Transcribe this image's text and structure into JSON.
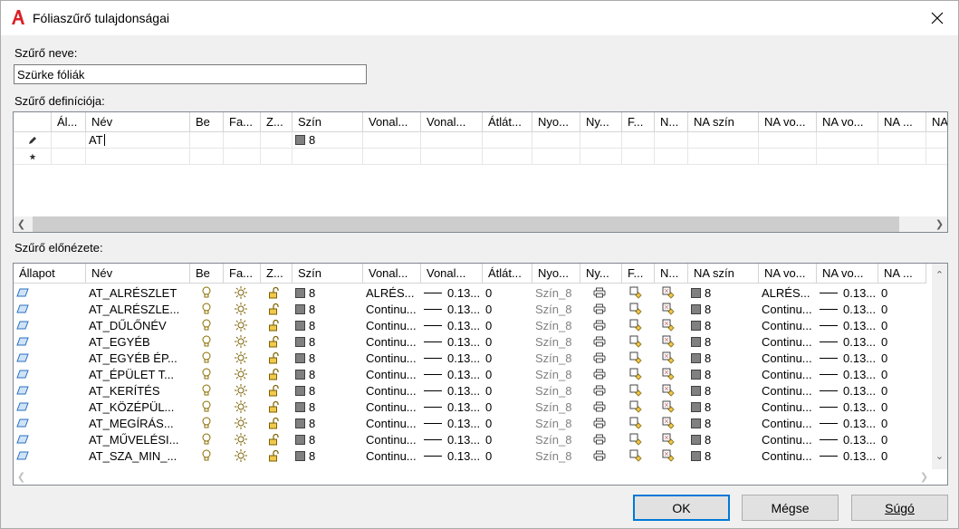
{
  "window": {
    "title": "Fóliaszűrő tulajdonságai"
  },
  "filter_name": {
    "label": "Szűrő neve:",
    "value": "Szürke fóliák"
  },
  "definition": {
    "label": "Szűrő definíciója:",
    "columns": [
      "",
      "Ál...",
      "Név",
      "Be",
      "Fa...",
      "Z...",
      "Szín",
      "Vonal...",
      "Vonal...",
      "Átlát...",
      "Nyo...",
      "Ny...",
      "F...",
      "N...",
      "NA szín",
      "NA vo...",
      "NA vo...",
      "NA ...",
      "NA"
    ],
    "rows": [
      {
        "marker": "pencil",
        "name": "AT",
        "color": "8"
      },
      {
        "marker": "new"
      }
    ]
  },
  "preview": {
    "label": "Szűrő előnézete:",
    "columns": [
      "Állapot",
      "Név",
      "Be",
      "Fa...",
      "Z...",
      "Szín",
      "Vonal...",
      "Vonal...",
      "Átlát...",
      "Nyo...",
      "Ny...",
      "F...",
      "N...",
      "NA szín",
      "NA vo...",
      "NA vo...",
      "NA ..."
    ],
    "rows": [
      {
        "name": "AT_ALRÉSZLET",
        "color": "8",
        "linetype": "ALRÉS...",
        "lineweight": "0.13...",
        "transparency": "0",
        "plotstyle": "Szín_8",
        "vp_color": "8",
        "vp_linetype": "ALRÉS...",
        "vp_lineweight": "0.13...",
        "vp_transparency": "0"
      },
      {
        "name": "AT_ALRÉSZLE...",
        "color": "8",
        "linetype": "Continu...",
        "lineweight": "0.13...",
        "transparency": "0",
        "plotstyle": "Szín_8",
        "vp_color": "8",
        "vp_linetype": "Continu...",
        "vp_lineweight": "0.13...",
        "vp_transparency": "0"
      },
      {
        "name": "AT_DŰLŐNÉV",
        "color": "8",
        "linetype": "Continu...",
        "lineweight": "0.13...",
        "transparency": "0",
        "plotstyle": "Szín_8",
        "vp_color": "8",
        "vp_linetype": "Continu...",
        "vp_lineweight": "0.13...",
        "vp_transparency": "0"
      },
      {
        "name": "AT_EGYÉB",
        "color": "8",
        "linetype": "Continu...",
        "lineweight": "0.13...",
        "transparency": "0",
        "plotstyle": "Szín_8",
        "vp_color": "8",
        "vp_linetype": "Continu...",
        "vp_lineweight": "0.13...",
        "vp_transparency": "0"
      },
      {
        "name": "AT_EGYÉB ÉP...",
        "color": "8",
        "linetype": "Continu...",
        "lineweight": "0.13...",
        "transparency": "0",
        "plotstyle": "Szín_8",
        "vp_color": "8",
        "vp_linetype": "Continu...",
        "vp_lineweight": "0.13...",
        "vp_transparency": "0"
      },
      {
        "name": "AT_ÉPÜLET T...",
        "color": "8",
        "linetype": "Continu...",
        "lineweight": "0.13...",
        "transparency": "0",
        "plotstyle": "Szín_8",
        "vp_color": "8",
        "vp_linetype": "Continu...",
        "vp_lineweight": "0.13...",
        "vp_transparency": "0"
      },
      {
        "name": "AT_KERÍTÉS",
        "color": "8",
        "linetype": "Continu...",
        "lineweight": "0.13...",
        "transparency": "0",
        "plotstyle": "Szín_8",
        "vp_color": "8",
        "vp_linetype": "Continu...",
        "vp_lineweight": "0.13...",
        "vp_transparency": "0"
      },
      {
        "name": "AT_KÖZÉPÜL...",
        "color": "8",
        "linetype": "Continu...",
        "lineweight": "0.13...",
        "transparency": "0",
        "plotstyle": "Szín_8",
        "vp_color": "8",
        "vp_linetype": "Continu...",
        "vp_lineweight": "0.13...",
        "vp_transparency": "0"
      },
      {
        "name": "AT_MEGÍRÁS...",
        "color": "8",
        "linetype": "Continu...",
        "lineweight": "0.13...",
        "transparency": "0",
        "plotstyle": "Szín_8",
        "vp_color": "8",
        "vp_linetype": "Continu...",
        "vp_lineweight": "0.13...",
        "vp_transparency": "0"
      },
      {
        "name": "AT_MŰVELÉSI...",
        "color": "8",
        "linetype": "Continu...",
        "lineweight": "0.13...",
        "transparency": "0",
        "plotstyle": "Szín_8",
        "vp_color": "8",
        "vp_linetype": "Continu...",
        "vp_lineweight": "0.13...",
        "vp_transparency": "0"
      },
      {
        "name": "AT_SZA_MIN_...",
        "color": "8",
        "linetype": "Continu...",
        "lineweight": "0.13...",
        "transparency": "0",
        "plotstyle": "Szín_8",
        "vp_color": "8",
        "vp_linetype": "Continu...",
        "vp_lineweight": "0.13...",
        "vp_transparency": "0"
      }
    ]
  },
  "buttons": {
    "ok": "OK",
    "cancel": "Mégse",
    "help": "Súgó"
  },
  "icons": {
    "app": "autocad-a-icon",
    "status": "layer-plane-icon",
    "on": "lightbulb-icon",
    "freeze": "sun-icon",
    "lock": "unlocked-padlock-icon",
    "plot": "printer-icon",
    "vp_freeze": "viewport-freeze-icon",
    "new_vp_freeze": "new-viewport-freeze-icon"
  },
  "colors": {
    "accent": "#0078d7",
    "app_icon": "#d91f26",
    "swatch": "#808080"
  }
}
